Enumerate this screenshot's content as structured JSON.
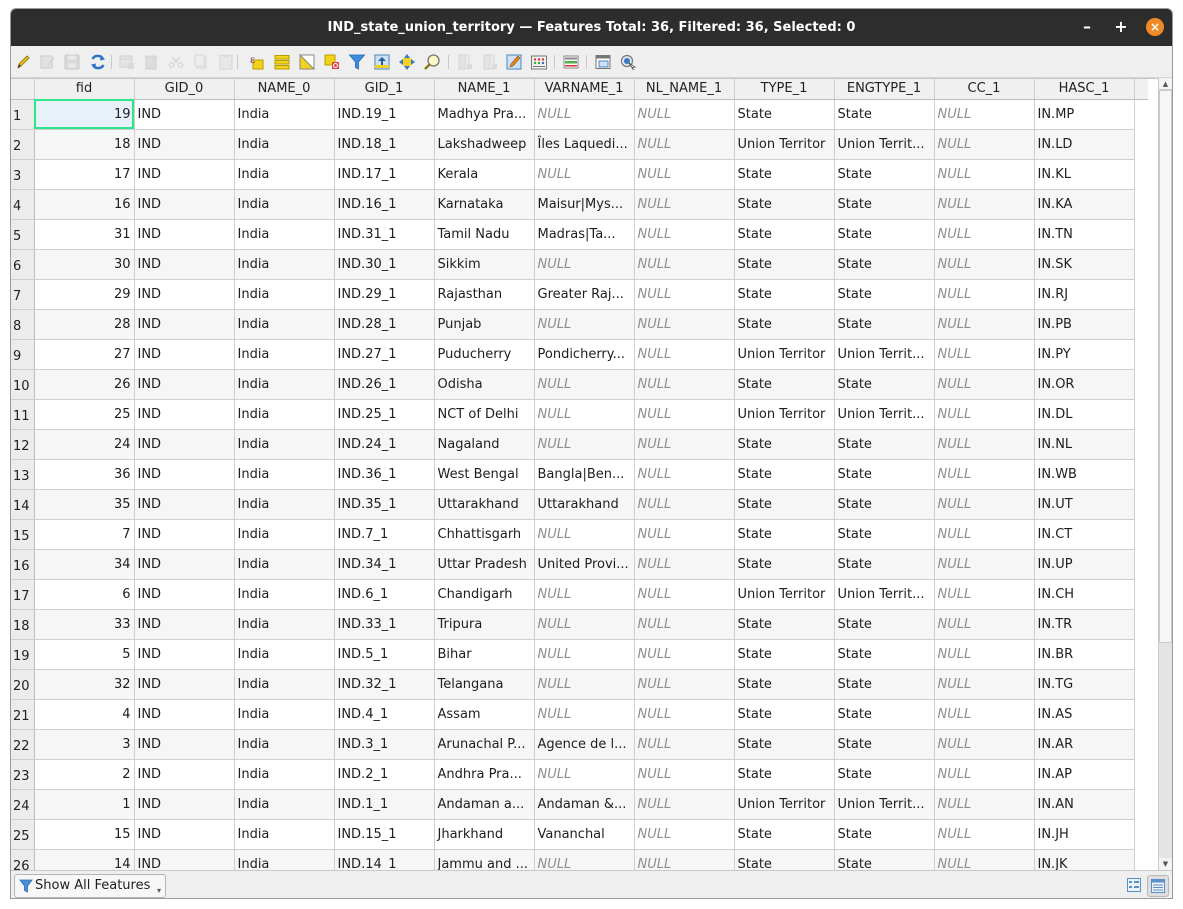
{
  "window": {
    "title": "IND_state_union_territory — Features Total: 36, Filtered: 36, Selected: 0",
    "minimize_label": "–",
    "maximize_label": "+",
    "close_label": "×"
  },
  "toolbar": {
    "items": [
      {
        "name": "toggle-editing-button",
        "icon": "pencil-icon",
        "enabled": true
      },
      {
        "name": "toggle-multi-edit-button",
        "icon": "multi-edit-icon",
        "enabled": false
      },
      {
        "name": "save-edits-button",
        "icon": "save-icon",
        "enabled": false
      },
      {
        "name": "reload-button",
        "icon": "reload-icon",
        "enabled": true
      },
      {
        "name": "add-feature-button",
        "icon": "add-feature-icon",
        "enabled": false
      },
      {
        "name": "delete-features-button",
        "icon": "trash-icon",
        "enabled": false
      },
      {
        "name": "cut-button",
        "icon": "scissors-icon",
        "enabled": false
      },
      {
        "name": "copy-button",
        "icon": "copy-icon",
        "enabled": false
      },
      {
        "name": "paste-button",
        "icon": "paste-icon",
        "enabled": false
      },
      {
        "name": "select-by-expression-button",
        "icon": "expression-select-icon",
        "enabled": true
      },
      {
        "name": "select-all-button",
        "icon": "select-all-icon",
        "enabled": true
      },
      {
        "name": "invert-selection-button",
        "icon": "invert-selection-icon",
        "enabled": true
      },
      {
        "name": "deselect-all-button",
        "icon": "deselect-icon",
        "enabled": true
      },
      {
        "name": "filter-select-button",
        "icon": "funnel-icon",
        "enabled": true
      },
      {
        "name": "move-selection-top-button",
        "icon": "move-top-icon",
        "enabled": true
      },
      {
        "name": "pan-to-selected-button",
        "icon": "pan-icon",
        "enabled": true
      },
      {
        "name": "zoom-to-selected-button",
        "icon": "zoom-icon",
        "enabled": true
      },
      {
        "name": "new-field-button",
        "icon": "new-field-icon",
        "enabled": false
      },
      {
        "name": "delete-field-button",
        "icon": "delete-field-icon",
        "enabled": false
      },
      {
        "name": "organize-columns-button",
        "icon": "edit-columns-icon",
        "enabled": true
      },
      {
        "name": "field-calculator-button",
        "icon": "calculator-icon",
        "enabled": true
      },
      {
        "name": "conditional-formatting-button",
        "icon": "conditional-format-icon",
        "enabled": true
      },
      {
        "name": "dock-button",
        "icon": "dock-icon",
        "enabled": true
      },
      {
        "name": "actions-button",
        "icon": "actions-icon",
        "enabled": true
      }
    ]
  },
  "table": {
    "columns": [
      "fid",
      "GID_0",
      "NAME_0",
      "GID_1",
      "NAME_1",
      "VARNAME_1",
      "NL_NAME_1",
      "TYPE_1",
      "ENGTYPE_1",
      "CC_1",
      "HASC_1"
    ],
    "null_label": "NULL",
    "selected_cell": {
      "row": 1,
      "column": "fid"
    },
    "rows": [
      {
        "n": "1",
        "cells": [
          "19",
          "IND",
          "India",
          "IND.19_1",
          "Madhya Pra...",
          null,
          null,
          "State",
          "State",
          null,
          "IN.MP"
        ]
      },
      {
        "n": "2",
        "cells": [
          "18",
          "IND",
          "India",
          "IND.18_1",
          "Lakshadweep",
          "Îles Laquedi...",
          null,
          "Union Territor",
          "Union Territ...",
          null,
          "IN.LD"
        ]
      },
      {
        "n": "3",
        "cells": [
          "17",
          "IND",
          "India",
          "IND.17_1",
          "Kerala",
          null,
          null,
          "State",
          "State",
          null,
          "IN.KL"
        ]
      },
      {
        "n": "4",
        "cells": [
          "16",
          "IND",
          "India",
          "IND.16_1",
          "Karnataka",
          "Maisur|Mys...",
          null,
          "State",
          "State",
          null,
          "IN.KA"
        ]
      },
      {
        "n": "5",
        "cells": [
          "31",
          "IND",
          "India",
          "IND.31_1",
          "Tamil Nadu",
          "Madras|Ta...",
          null,
          "State",
          "State",
          null,
          "IN.TN"
        ]
      },
      {
        "n": "6",
        "cells": [
          "30",
          "IND",
          "India",
          "IND.30_1",
          "Sikkim",
          null,
          null,
          "State",
          "State",
          null,
          "IN.SK"
        ]
      },
      {
        "n": "7",
        "cells": [
          "29",
          "IND",
          "India",
          "IND.29_1",
          "Rajasthan",
          "Greater Raj...",
          null,
          "State",
          "State",
          null,
          "IN.RJ"
        ]
      },
      {
        "n": "8",
        "cells": [
          "28",
          "IND",
          "India",
          "IND.28_1",
          "Punjab",
          null,
          null,
          "State",
          "State",
          null,
          "IN.PB"
        ]
      },
      {
        "n": "9",
        "cells": [
          "27",
          "IND",
          "India",
          "IND.27_1",
          "Puducherry",
          "Pondicherry...",
          null,
          "Union Territor",
          "Union Territ...",
          null,
          "IN.PY"
        ]
      },
      {
        "n": "10",
        "cells": [
          "26",
          "IND",
          "India",
          "IND.26_1",
          "Odisha",
          null,
          null,
          "State",
          "State",
          null,
          "IN.OR"
        ]
      },
      {
        "n": "11",
        "cells": [
          "25",
          "IND",
          "India",
          "IND.25_1",
          "NCT of Delhi",
          null,
          null,
          "Union Territor",
          "Union Territ...",
          null,
          "IN.DL"
        ]
      },
      {
        "n": "12",
        "cells": [
          "24",
          "IND",
          "India",
          "IND.24_1",
          "Nagaland",
          null,
          null,
          "State",
          "State",
          null,
          "IN.NL"
        ]
      },
      {
        "n": "13",
        "cells": [
          "36",
          "IND",
          "India",
          "IND.36_1",
          "West Bengal",
          "Bangla|Ben...",
          null,
          "State",
          "State",
          null,
          "IN.WB"
        ]
      },
      {
        "n": "14",
        "cells": [
          "35",
          "IND",
          "India",
          "IND.35_1",
          "Uttarakhand",
          "Uttarakhand",
          null,
          "State",
          "State",
          null,
          "IN.UT"
        ]
      },
      {
        "n": "15",
        "cells": [
          "7",
          "IND",
          "India",
          "IND.7_1",
          "Chhattisgarh",
          null,
          null,
          "State",
          "State",
          null,
          "IN.CT"
        ]
      },
      {
        "n": "16",
        "cells": [
          "34",
          "IND",
          "India",
          "IND.34_1",
          "Uttar Pradesh",
          "United Provi...",
          null,
          "State",
          "State",
          null,
          "IN.UP"
        ]
      },
      {
        "n": "17",
        "cells": [
          "6",
          "IND",
          "India",
          "IND.6_1",
          "Chandigarh",
          null,
          null,
          "Union Territor",
          "Union Territ...",
          null,
          "IN.CH"
        ]
      },
      {
        "n": "18",
        "cells": [
          "33",
          "IND",
          "India",
          "IND.33_1",
          "Tripura",
          null,
          null,
          "State",
          "State",
          null,
          "IN.TR"
        ]
      },
      {
        "n": "19",
        "cells": [
          "5",
          "IND",
          "India",
          "IND.5_1",
          "Bihar",
          null,
          null,
          "State",
          "State",
          null,
          "IN.BR"
        ]
      },
      {
        "n": "20",
        "cells": [
          "32",
          "IND",
          "India",
          "IND.32_1",
          "Telangana",
          null,
          null,
          "State",
          "State",
          null,
          "IN.TG"
        ]
      },
      {
        "n": "21",
        "cells": [
          "4",
          "IND",
          "India",
          "IND.4_1",
          "Assam",
          null,
          null,
          "State",
          "State",
          null,
          "IN.AS"
        ]
      },
      {
        "n": "22",
        "cells": [
          "3",
          "IND",
          "India",
          "IND.3_1",
          "Arunachal P...",
          "Agence de l...",
          null,
          "State",
          "State",
          null,
          "IN.AR"
        ]
      },
      {
        "n": "23",
        "cells": [
          "2",
          "IND",
          "India",
          "IND.2_1",
          "Andhra Pra...",
          null,
          null,
          "State",
          "State",
          null,
          "IN.AP"
        ]
      },
      {
        "n": "24",
        "cells": [
          "1",
          "IND",
          "India",
          "IND.1_1",
          "Andaman a...",
          "Andaman &...",
          null,
          "Union Territor",
          "Union Territ...",
          null,
          "IN.AN"
        ]
      },
      {
        "n": "25",
        "cells": [
          "15",
          "IND",
          "India",
          "IND.15_1",
          "Jharkhand",
          "Vananchal",
          null,
          "State",
          "State",
          null,
          "IN.JH"
        ]
      },
      {
        "n": "26",
        "cells": [
          "14",
          "IND",
          "India",
          "IND.14_1",
          "Jammu and ...",
          null,
          null,
          "State",
          "State",
          null,
          "IN.JK"
        ]
      }
    ]
  },
  "scrollbar": {
    "visible_fraction": 0.72,
    "position": 0.0
  },
  "bottombar": {
    "filter_button_label": "Show All Features",
    "form_view_icon": "form-view-icon",
    "table_view_icon": "table-view-icon",
    "active_view": "table"
  },
  "colors": {
    "titlebar": "#2d2d2d",
    "close_button": "#f08a24",
    "selection_outline": "#2ee68a",
    "null_text": "#8e8e8e"
  }
}
